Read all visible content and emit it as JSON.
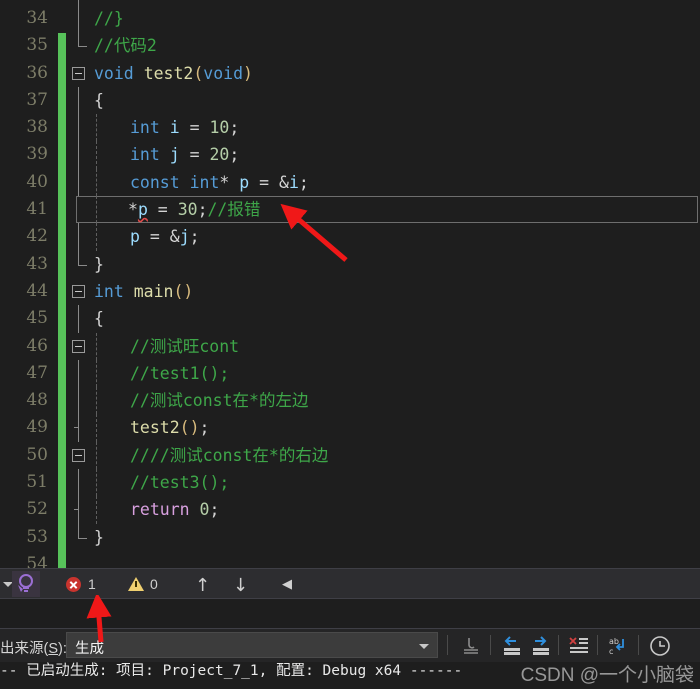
{
  "editor": {
    "language": "C",
    "theme_bg": "#1e1e1e",
    "current_line": 42,
    "first_visible_line": 34,
    "lines": [
      {
        "n": "34",
        "text": "",
        "clipped": true
      },
      {
        "n": "35",
        "text": "//}"
      },
      {
        "n": "36",
        "text": "//代码2"
      },
      {
        "n": "37",
        "text": "void test2(void)"
      },
      {
        "n": "38",
        "text": "{"
      },
      {
        "n": "39",
        "text": "int i = 10;"
      },
      {
        "n": "40",
        "text": "int j = 20;"
      },
      {
        "n": "41",
        "text": "const int* p = &i;"
      },
      {
        "n": "42",
        "text": "*p = 30;//报错"
      },
      {
        "n": "43",
        "text": "p = &j;"
      },
      {
        "n": "44",
        "text": "}"
      },
      {
        "n": "45",
        "text": "int main()"
      },
      {
        "n": "46",
        "text": "{"
      },
      {
        "n": "47",
        "text": "//测试旺cont"
      },
      {
        "n": "48",
        "text": "//test1();"
      },
      {
        "n": "49",
        "text": "//测试const在*的左边"
      },
      {
        "n": "50",
        "text": "test2();"
      },
      {
        "n": "51",
        "text": "////测试const在*的右边"
      },
      {
        "n": "52",
        "text": "//test3();"
      },
      {
        "n": "53",
        "text": "return 0;"
      },
      {
        "n": "54",
        "text": "}"
      }
    ],
    "tokens": {
      "kw_void": "void",
      "kw_int": "int",
      "kw_const": "const",
      "kw_return": "return",
      "fn_test2": "test2",
      "fn_main": "main",
      "var_i": "i",
      "var_j": "j",
      "var_p": "p",
      "num_10": "10",
      "num_20": "20",
      "num_30": "30",
      "num_0": "0",
      "cmt_close_brace": "//}",
      "cmt_code2": "//代码2",
      "cmt_baocuo": "//报错",
      "cmt_no_const": "//测试旺cont",
      "cmt_test1": "//test1();",
      "cmt_const_left": "//测试const在*的左边",
      "cmt_const_right": "////测试const在*的右边",
      "cmt_test3": "//test3();"
    },
    "colors": {
      "keyword": "#569cd6",
      "control": "#d8a0df",
      "function": "#dcdcaa",
      "variable": "#9cdcfe",
      "number": "#b5cea8",
      "comment": "#3ea749",
      "punctuation": "#d4d4d4",
      "paren": "#d7ba7d",
      "error_squiggle": "#e04a4a",
      "change_bar": "#57c25a",
      "annotation_arrow": "#f01818"
    }
  },
  "error_bar": {
    "pin_icon": "pin-lightbulb-icon",
    "error_icon": "error-circle-icon",
    "error_count": "1",
    "warning_icon": "warning-triangle-icon",
    "warning_count": "0",
    "nav_up": "↑",
    "nav_down": "↓",
    "nav_prev": "◀"
  },
  "output_pane": {
    "source_label_pre": "出来源(",
    "source_label_key": "S",
    "source_label_post": "):",
    "selected_source": "生成",
    "toolbar_icons": [
      "find-icon",
      "navigate-back-icon",
      "navigate-forward-icon",
      "clear-all-icon",
      "word-wrap-icon",
      "show-timestamps-icon"
    ],
    "text": "-- 已启动生成: 项目: Project_7_1, 配置: Debug x64 ------"
  },
  "watermark": {
    "text": "CSDN @一个小脑袋"
  }
}
